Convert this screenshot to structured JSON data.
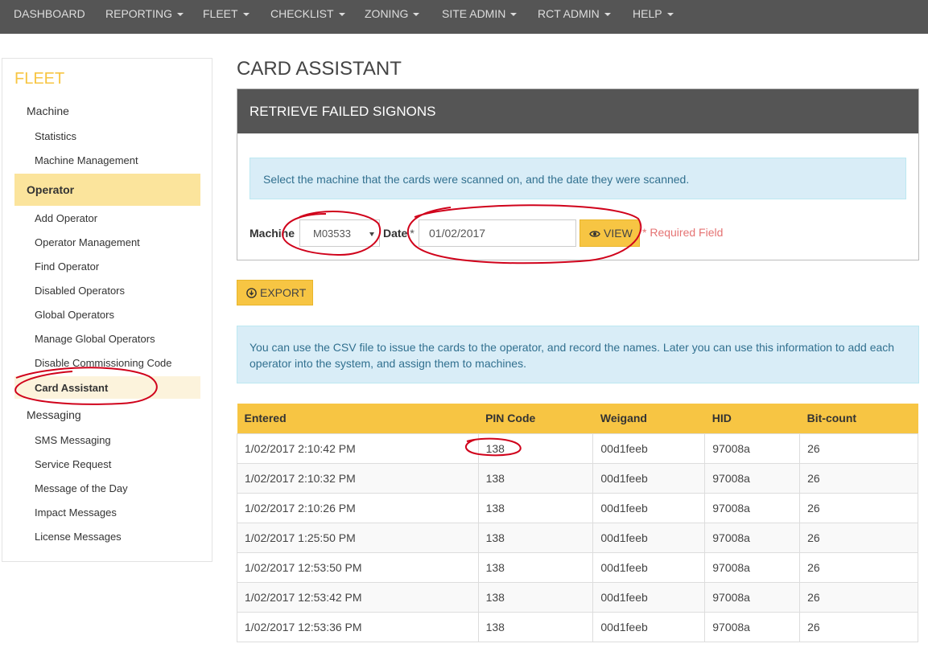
{
  "nav": {
    "items": [
      {
        "label": "DASHBOARD",
        "dropdown": false
      },
      {
        "label": "REPORTING",
        "dropdown": true
      },
      {
        "label": "FLEET",
        "dropdown": true
      },
      {
        "label": "CHECKLIST",
        "dropdown": true
      },
      {
        "label": "ZONING",
        "dropdown": true
      },
      {
        "label": "SITE ADMIN",
        "dropdown": true
      },
      {
        "label": "RCT ADMIN",
        "dropdown": true
      },
      {
        "label": "HELP",
        "dropdown": true
      }
    ]
  },
  "sidebar": {
    "title": "FLEET",
    "machine": {
      "label": "Machine",
      "items": [
        "Statistics",
        "Machine Management"
      ]
    },
    "operator": {
      "label": "Operator",
      "items": [
        "Add Operator",
        "Operator Management",
        "Find Operator",
        "Disabled Operators",
        "Global Operators",
        "Manage Global Operators",
        "Disable Commissioning Code",
        "Card Assistant"
      ],
      "active": "Card Assistant"
    },
    "messaging": {
      "label": "Messaging",
      "items": [
        "SMS Messaging",
        "Service Request",
        "Message of the Day",
        "Impact Messages",
        "License Messages"
      ]
    }
  },
  "page": {
    "title": "CARD ASSISTANT"
  },
  "panel": {
    "title": "RETRIEVE FAILED SIGNONS",
    "info": "Select the machine that the cards were scanned on, and the date they were scanned.",
    "machine_label": "Machine",
    "machine_value": "M03533",
    "date_label": "Date",
    "date_required_mark": "*",
    "date_value": "01/02/2017",
    "view_label": "VIEW",
    "required_text": "* Required Field"
  },
  "export_label": "EXPORT",
  "info2": "You can use the CSV file to issue the cards to the operator, and record the names. Later you can use this information to add each operator into the system, and assign them to machines.",
  "table": {
    "headers": [
      "Entered",
      "PIN Code",
      "Weigand",
      "HID",
      "Bit-count"
    ],
    "rows": [
      [
        "1/02/2017 2:10:42 PM",
        "138",
        "00d1feeb",
        "97008a",
        "26"
      ],
      [
        "1/02/2017 2:10:32 PM",
        "138",
        "00d1feeb",
        "97008a",
        "26"
      ],
      [
        "1/02/2017 2:10:26 PM",
        "138",
        "00d1feeb",
        "97008a",
        "26"
      ],
      [
        "1/02/2017 1:25:50 PM",
        "138",
        "00d1feeb",
        "97008a",
        "26"
      ],
      [
        "1/02/2017 12:53:50 PM",
        "138",
        "00d1feeb",
        "97008a",
        "26"
      ],
      [
        "1/02/2017 12:53:42 PM",
        "138",
        "00d1feeb",
        "97008a",
        "26"
      ],
      [
        "1/02/2017 12:53:36 PM",
        "138",
        "00d1feeb",
        "97008a",
        "26"
      ]
    ]
  },
  "colors": {
    "accent": "#f7c543",
    "nav_bg": "#555555",
    "annotation": "#d0021b"
  },
  "icons": {
    "view": "eye-icon",
    "export": "download-circle-icon"
  }
}
